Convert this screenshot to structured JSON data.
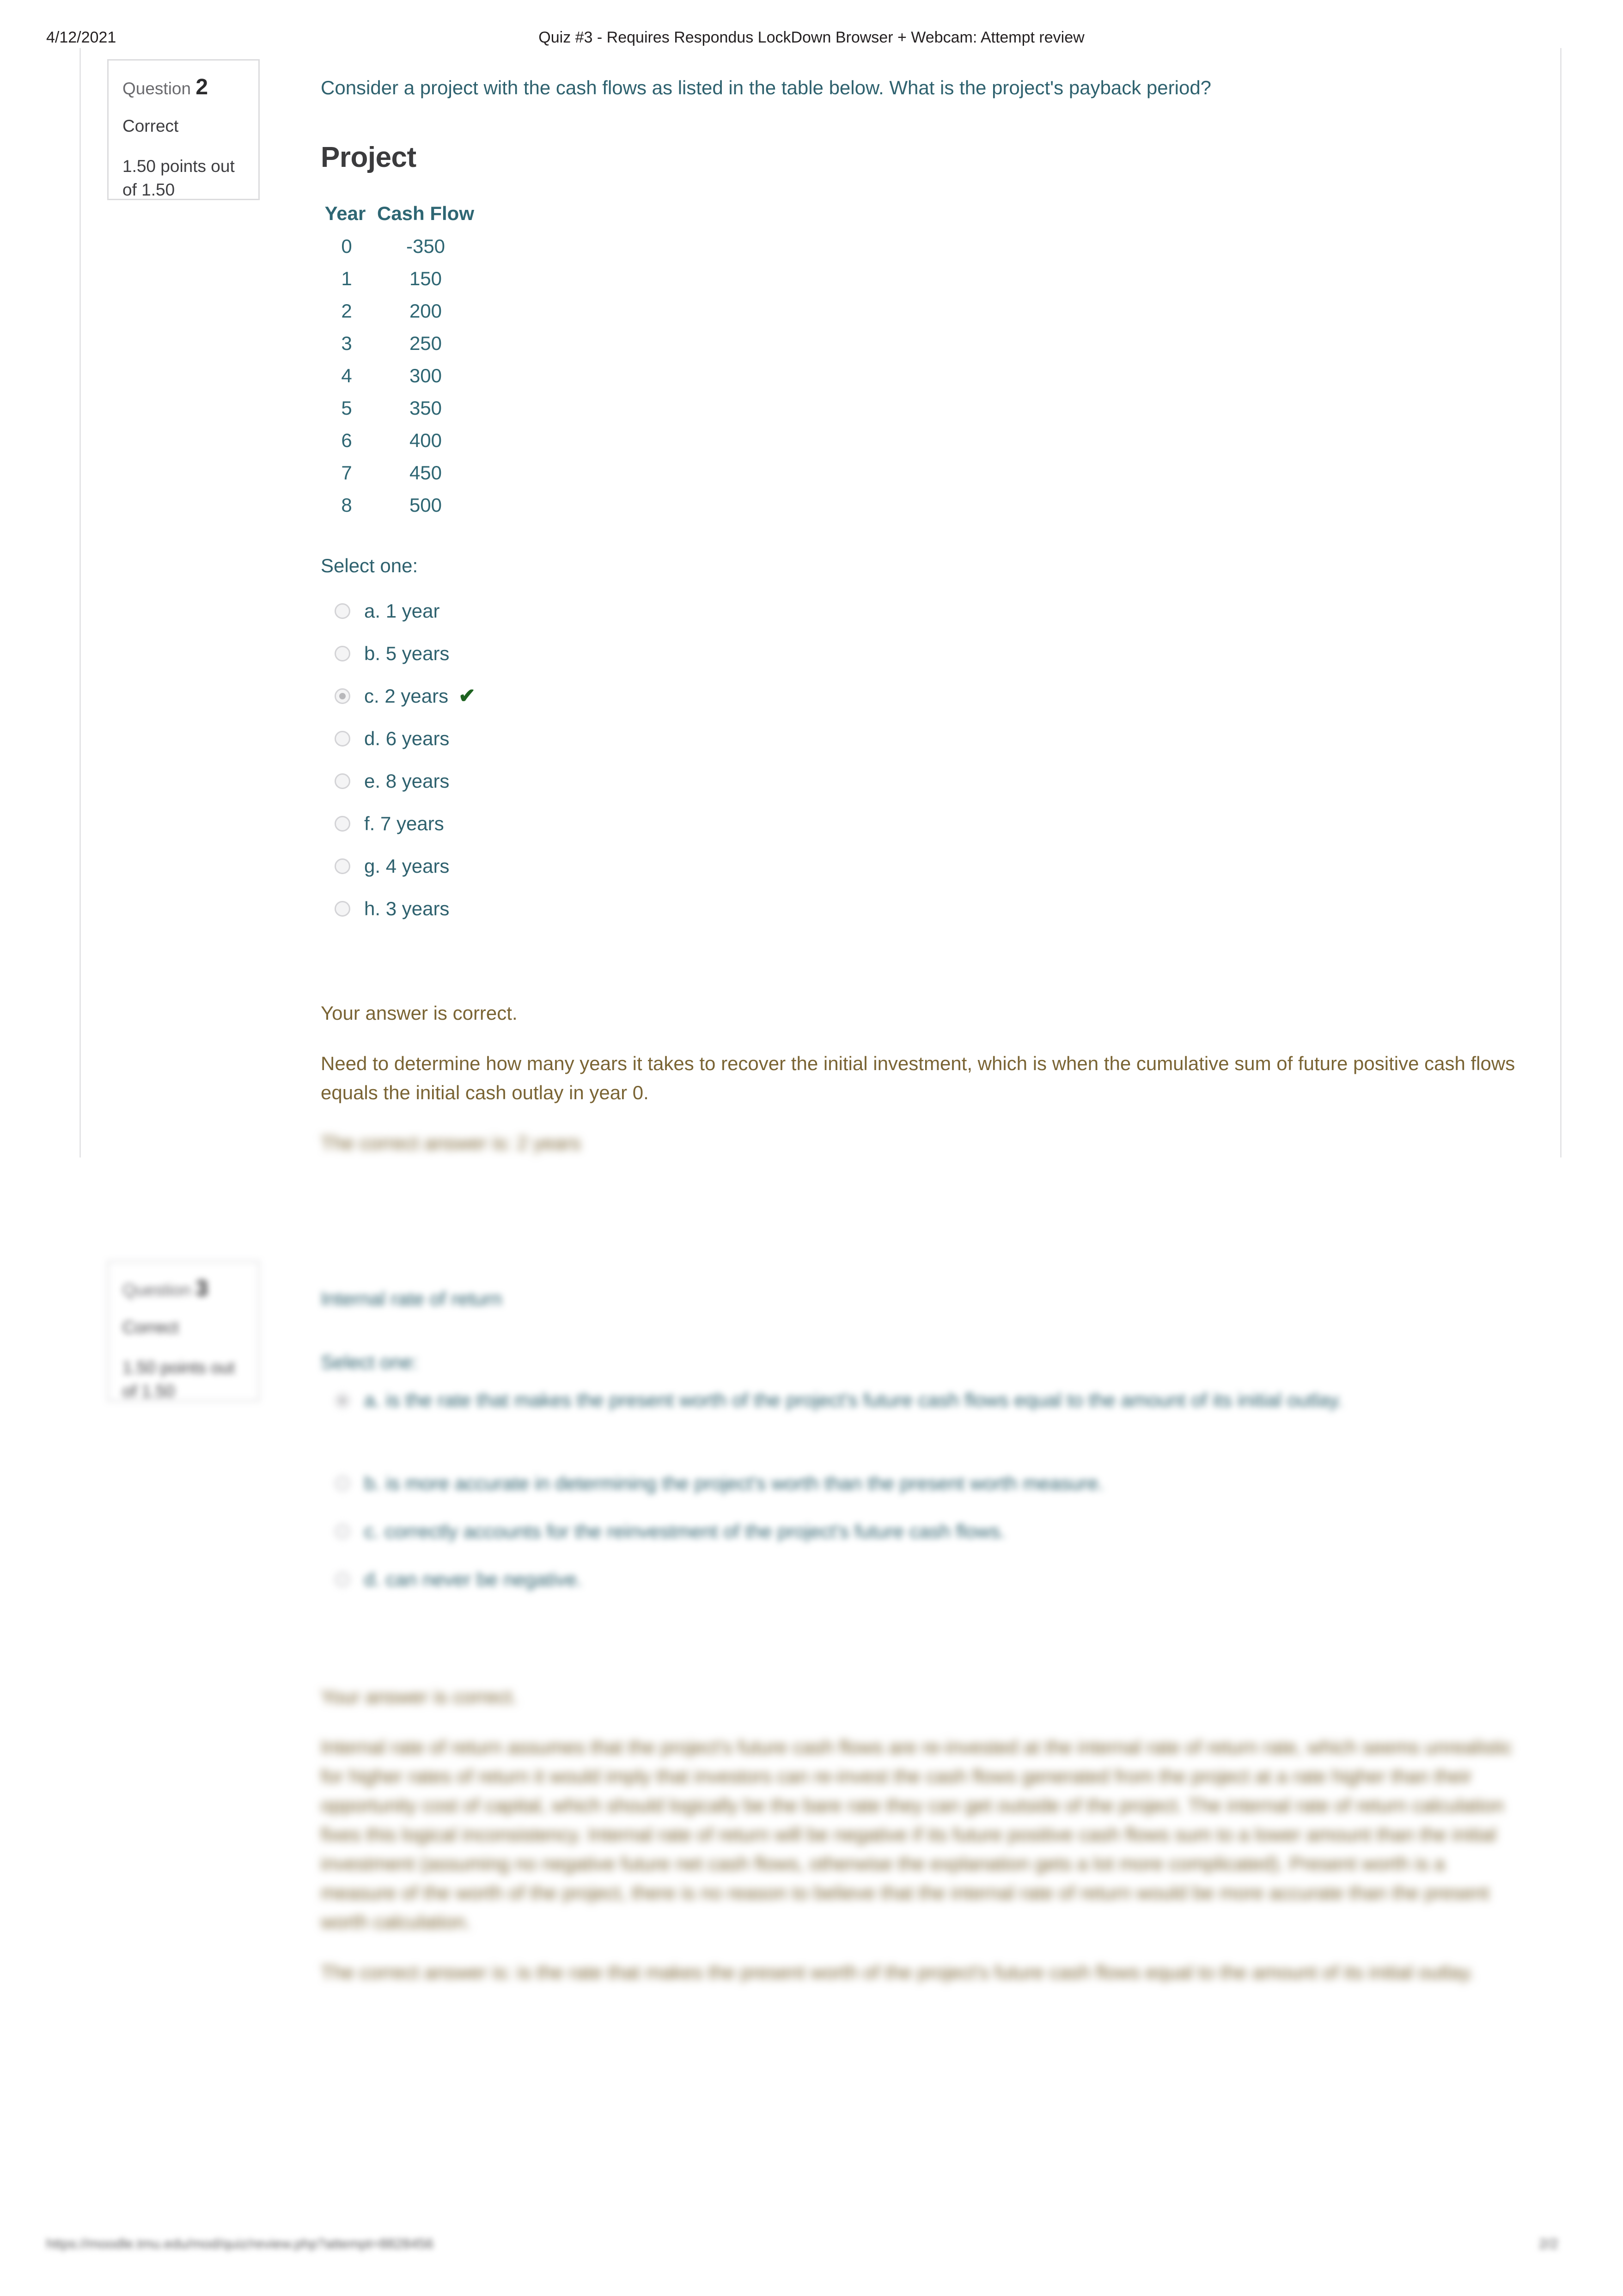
{
  "print_header": {
    "date": "4/12/2021",
    "title": "Quiz #3 - Requires Respondus LockDown Browser + Webcam: Attempt review"
  },
  "colors": {
    "question_text": "#2e616e",
    "table_header": "#2e6673",
    "feedback": "#7a6434",
    "correct_tick": "#1d6220",
    "heading": "#3b3b3d",
    "box_border": "#dcdcde"
  },
  "questions": [
    {
      "info": {
        "number_label": "Question",
        "number": "2",
        "state": "Correct",
        "grade": "1.50 points out of 1.50"
      },
      "stem": "Consider a project with the cash flows as listed in the table below. What is the project's payback period?",
      "table": {
        "title": "Project",
        "headers": [
          "Year",
          "Cash Flow"
        ],
        "rows": [
          [
            "0",
            "-350"
          ],
          [
            "1",
            "150"
          ],
          [
            "2",
            "200"
          ],
          [
            "3",
            "250"
          ],
          [
            "4",
            "300"
          ],
          [
            "5",
            "350"
          ],
          [
            "6",
            "400"
          ],
          [
            "7",
            "450"
          ],
          [
            "8",
            "500"
          ]
        ]
      },
      "select_prompt": "Select one:",
      "options": [
        {
          "label": "a. 1 year",
          "selected": false,
          "correct": false
        },
        {
          "label": "b. 5 years",
          "selected": false,
          "correct": false
        },
        {
          "label": "c. 2 years",
          "selected": true,
          "correct": true
        },
        {
          "label": "d. 6 years",
          "selected": false,
          "correct": false
        },
        {
          "label": "e. 8 years",
          "selected": false,
          "correct": false
        },
        {
          "label": "f. 7 years",
          "selected": false,
          "correct": false
        },
        {
          "label": "g. 4 years",
          "selected": false,
          "correct": false
        },
        {
          "label": "h. 3 years",
          "selected": false,
          "correct": false
        }
      ],
      "correct_tick_glyph": "✔",
      "feedback": {
        "verdict": "Your answer is correct.",
        "explanation": "Need to determine how many years it takes to recover the initial investment, which is when the cumulative sum of future positive cash flows equals the initial cash outlay in year 0.",
        "correct_answer": "The correct answer is: 2 years"
      }
    },
    {
      "info": {
        "number_label": "Question",
        "number": "3",
        "state": "Correct",
        "grade": "1.50 points out of 1.50"
      },
      "stem": "Internal rate of return",
      "select_prompt": "Select one:",
      "options": [
        {
          "label": "a. is the rate that makes the present worth of the project's future cash flows equal to the amount of its initial outlay.",
          "selected": true,
          "correct": true
        },
        {
          "label": "b. is more accurate in determining the project's worth than the present worth measure.",
          "selected": false,
          "correct": false
        },
        {
          "label": "c. correctly accounts for the reinvestment of the project's future cash flows.",
          "selected": false,
          "correct": false
        },
        {
          "label": "d. can never be negative.",
          "selected": false,
          "correct": false
        }
      ],
      "correct_tick_glyph": "✔",
      "feedback": {
        "verdict": "Your answer is correct.",
        "explanation": "Internal rate of return assumes that the project's future cash flows are re-invested at the internal rate of return rate, which seems unrealistic for higher rates of return it would imply that investors can re-invest the cash flows generated from the project at a rate higher than their opportunity cost of capital, which should logically be the bare rate they can get outside of the project. The internal rate of return calculation fixes this logical inconsistency. Internal rate of return will be negative if its future positive cash flows sum to a lower amount than the initial investment (assuming no negative future net cash flows, otherwise the explanation gets a lot more complicated). Present worth is a measure of the worth of the project, there is no reason to believe that the internal rate of return would be more accurate than the present worth calculation.",
        "correct_answer": "The correct answer is: is the rate that makes the present worth of the project's future cash flows equal to the amount of its initial outlay."
      }
    }
  ],
  "footer": {
    "url": "https://moodle.tmu.edu/mod/quiz/review.php?attempt=8828456",
    "page_number": "2/2"
  }
}
